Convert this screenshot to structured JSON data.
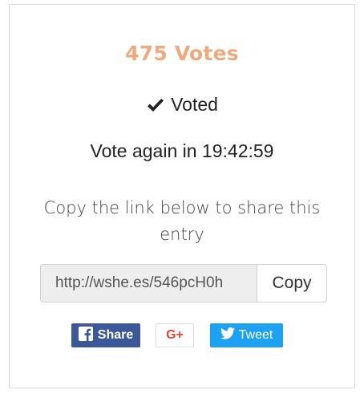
{
  "votes": {
    "label": "475 Votes",
    "color": "#f0a97e"
  },
  "status": {
    "voted_label": "Voted",
    "check_icon": "check-icon"
  },
  "countdown": {
    "text": "Vote again in 19:42:59"
  },
  "share": {
    "instruction": "Copy the link below to share this entry",
    "link_value": "http://wshe.es/546pcH0h",
    "copy_label": "Copy"
  },
  "social": {
    "facebook": {
      "label": "Share",
      "icon": "facebook-icon",
      "color": "#3b5998"
    },
    "google": {
      "label": "G+",
      "color": "#dd4b39"
    },
    "twitter": {
      "label": "Tweet",
      "icon": "twitter-bird-icon",
      "color": "#1da1f2"
    }
  }
}
